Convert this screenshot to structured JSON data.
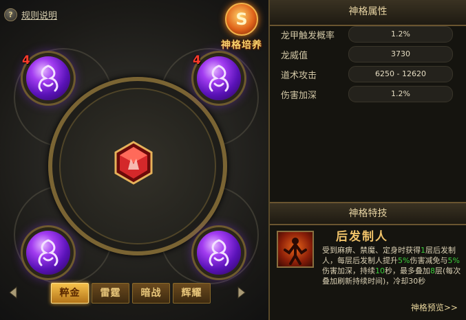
{
  "rules_link": "规则说明",
  "emblem": {
    "title": "神格培养",
    "glyph": "S"
  },
  "orbs": [
    {
      "badge": "4"
    },
    {
      "badge": "4"
    },
    {
      "badge": ""
    },
    {
      "badge": ""
    }
  ],
  "tabs": [
    "粹金",
    "雷霆",
    "暗战",
    "辉耀"
  ],
  "active_tab": 0,
  "attributes": {
    "header": "神格属性",
    "items": [
      {
        "label": "龙甲触发概率",
        "value": "1.2%"
      },
      {
        "label": "龙威值",
        "value": "3730"
      },
      {
        "label": "道术攻击",
        "value": "6250 - 12620"
      },
      {
        "label": "伤害加深",
        "value": "1.2%"
      }
    ]
  },
  "skill": {
    "header": "神格特技",
    "name": "后发制人",
    "desc": [
      {
        "t": "受到麻痹、禁魔、定身时获得",
        "c": ""
      },
      {
        "t": "1",
        "c": "hl"
      },
      {
        "t": "层后发制人，每层后发制人提升",
        "c": ""
      },
      {
        "t": "5%",
        "c": "hl"
      },
      {
        "t": "伤害减免与",
        "c": ""
      },
      {
        "t": "5%",
        "c": "hl"
      },
      {
        "t": "伤害加深，持续",
        "c": ""
      },
      {
        "t": "10",
        "c": "hl"
      },
      {
        "t": "秒，最多叠加",
        "c": ""
      },
      {
        "t": "8",
        "c": "hl"
      },
      {
        "t": "层(每次叠加刷新持续时间)，冷却30秒",
        "c": ""
      }
    ],
    "preview_link": "神格预览>>"
  },
  "colors": {
    "accent_gold": "#f6d16b",
    "highlight_green": "#3ccf3c",
    "orb_purple": "#a23cf0",
    "gem_red": "#d4282a"
  }
}
